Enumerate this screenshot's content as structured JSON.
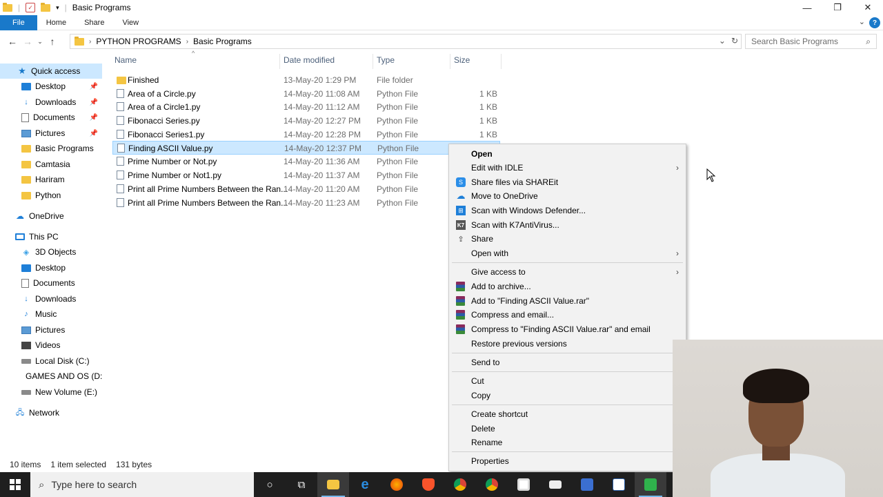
{
  "window": {
    "title": "Basic Programs",
    "controls": [
      "—",
      "❐",
      "✕"
    ]
  },
  "ribbon": {
    "tabs": [
      "File",
      "Home",
      "Share",
      "View"
    ]
  },
  "address": {
    "crumbs": [
      "PYTHON PROGRAMS",
      "Basic Programs"
    ],
    "search_placeholder": "Search Basic Programs"
  },
  "sidebar": {
    "items": [
      {
        "label": "Quick access",
        "icon": "star-icon"
      },
      {
        "label": "Desktop",
        "icon": "desktop-icon",
        "pinned": true
      },
      {
        "label": "Downloads",
        "icon": "download-icon",
        "pinned": true
      },
      {
        "label": "Documents",
        "icon": "document-icon",
        "pinned": true
      },
      {
        "label": "Pictures",
        "icon": "pictures-icon",
        "pinned": true
      },
      {
        "label": "Basic Programs",
        "icon": "folder-icon"
      },
      {
        "label": "Camtasia",
        "icon": "folder-icon"
      },
      {
        "label": "Hariram",
        "icon": "folder-icon"
      },
      {
        "label": "Python",
        "icon": "folder-icon"
      },
      {
        "label": "OneDrive",
        "icon": "onedrive-icon"
      },
      {
        "label": "This PC",
        "icon": "computer-icon"
      },
      {
        "label": "3D Objects",
        "icon": "3d-objects-icon"
      },
      {
        "label": "Desktop",
        "icon": "desktop-icon"
      },
      {
        "label": "Documents",
        "icon": "document-icon"
      },
      {
        "label": "Downloads",
        "icon": "download-icon"
      },
      {
        "label": "Music",
        "icon": "music-icon"
      },
      {
        "label": "Pictures",
        "icon": "pictures-icon"
      },
      {
        "label": "Videos",
        "icon": "videos-icon"
      },
      {
        "label": "Local Disk (C:)",
        "icon": "drive-icon"
      },
      {
        "label": "GAMES AND OS (D:",
        "icon": "drive-icon"
      },
      {
        "label": "New Volume (E:)",
        "icon": "drive-icon"
      },
      {
        "label": "Network",
        "icon": "network-icon"
      }
    ]
  },
  "columns": [
    "Name",
    "Date modified",
    "Type",
    "Size"
  ],
  "files": [
    {
      "name": "Finished",
      "date": "13-May-20 1:29 PM",
      "type": "File folder",
      "size": "",
      "folder": true
    },
    {
      "name": "Area of a Circle.py",
      "date": "14-May-20 11:08 AM",
      "type": "Python File",
      "size": "1 KB"
    },
    {
      "name": "Area of a Circle1.py",
      "date": "14-May-20 11:12 AM",
      "type": "Python File",
      "size": "1 KB"
    },
    {
      "name": "Fibonacci Series.py",
      "date": "14-May-20 12:27 PM",
      "type": "Python File",
      "size": "1 KB"
    },
    {
      "name": "Fibonacci Series1.py",
      "date": "14-May-20 12:28 PM",
      "type": "Python File",
      "size": "1 KB"
    },
    {
      "name": "Finding ASCII Value.py",
      "date": "14-May-20 12:37 PM",
      "type": "Python File",
      "size": "",
      "selected": true
    },
    {
      "name": "Prime Number or Not.py",
      "date": "14-May-20 11:36 AM",
      "type": "Python File",
      "size": ""
    },
    {
      "name": "Prime Number or Not1.py",
      "date": "14-May-20 11:37 AM",
      "type": "Python File",
      "size": ""
    },
    {
      "name": "Print all Prime Numbers Between the Ran...",
      "date": "14-May-20 11:20 AM",
      "type": "Python File",
      "size": ""
    },
    {
      "name": "Print all Prime Numbers Between the Ran...",
      "date": "14-May-20 11:23 AM",
      "type": "Python File",
      "size": ""
    }
  ],
  "status": {
    "count": "10 items",
    "selection": "1 item selected",
    "size": "131 bytes"
  },
  "context_menu": {
    "open": "Open",
    "edit_idle": "Edit with IDLE",
    "shareit": "Share files via SHAREit",
    "onedrive": "Move to OneDrive",
    "defender": "Scan with Windows Defender...",
    "k7": "Scan with K7AntiVirus...",
    "share": "Share",
    "open_with": "Open with",
    "give_access": "Give access to",
    "add_archive": "Add to archive...",
    "add_rar": "Add to \"Finding ASCII Value.rar\"",
    "compress_email": "Compress and email...",
    "compress_rar_email": "Compress to \"Finding ASCII Value.rar\" and email",
    "restore": "Restore previous versions",
    "send_to": "Send to",
    "cut": "Cut",
    "copy": "Copy",
    "create_shortcut": "Create shortcut",
    "delete": "Delete",
    "rename": "Rename",
    "properties": "Properties"
  },
  "taskbar": {
    "search_placeholder": "Type here to search",
    "apps": [
      "cortana-icon",
      "task-view-icon",
      "file-explorer-icon",
      "edge-icon",
      "firefox-icon",
      "brave-icon",
      "chrome-icon",
      "chrome-alt-icon",
      "store-icon",
      "mail-icon",
      "devcpp-icon",
      "python-file-icon",
      "camtasia-icon"
    ]
  },
  "colors": {
    "accent": "#1979ca",
    "selection": "#cce8ff",
    "taskbar": "#1f1f1f"
  }
}
